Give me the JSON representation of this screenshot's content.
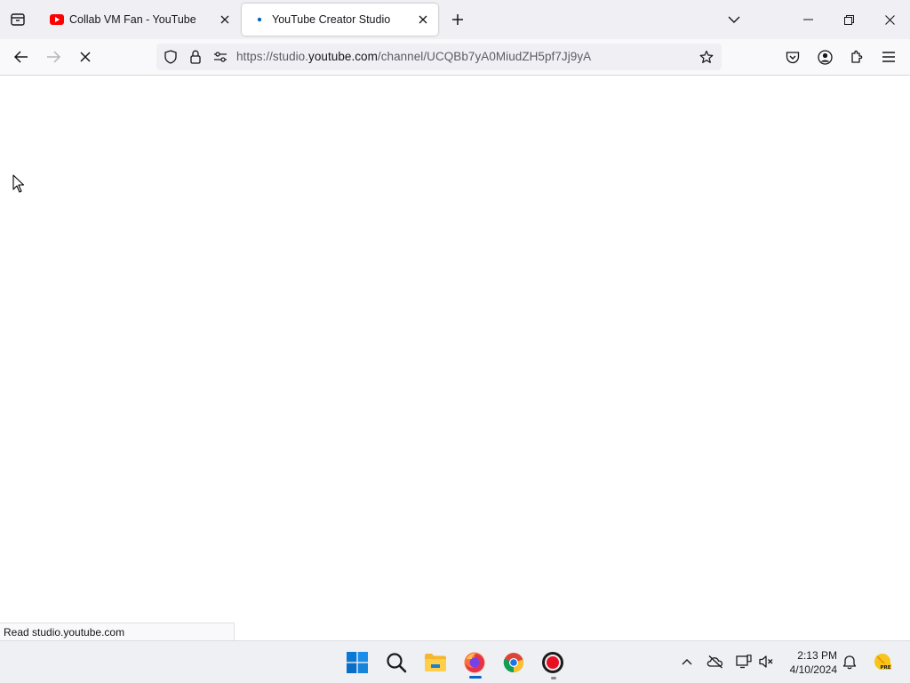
{
  "tabs": [
    {
      "title": "Collab VM Fan - YouTube",
      "favicon": "youtube-icon",
      "active": false
    },
    {
      "title": "YouTube Creator Studio",
      "favicon": "loading-dot-icon",
      "active": true
    }
  ],
  "url": {
    "prefix": "https://studio.",
    "domain": "youtube.com",
    "path": "/channel/UCQBb7yA0MiudZH5pf7Jj9yA"
  },
  "status_text": "Read studio.youtube.com",
  "clock": {
    "time": "2:13 PM",
    "date": "4/10/2024"
  },
  "taskbar_apps": [
    "start-icon",
    "search-icon",
    "file-explorer-icon",
    "firefox-icon",
    "chrome-icon",
    "recorder-icon"
  ],
  "tray_icons": [
    "chevron-up-icon",
    "onedrive-offline-icon",
    "display-icon",
    "volume-muted-icon",
    "bell-icon",
    "weather-icon"
  ],
  "colors": {
    "accent": "#0a64c8",
    "youtube_red": "#ff0000",
    "tab_strip": "#f0f0f4"
  }
}
